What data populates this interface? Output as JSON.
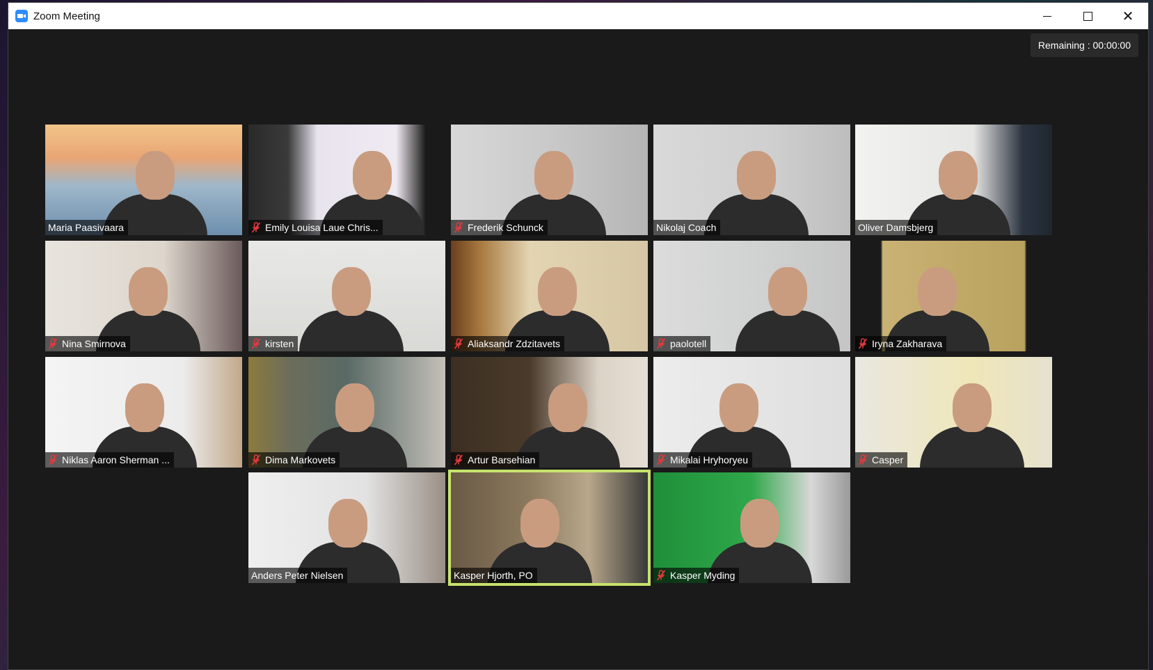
{
  "window": {
    "title": "Zoom Meeting"
  },
  "timer": {
    "label": "Remaining : 00:00:00"
  },
  "colors": {
    "speaking_outline": "#c7e36c",
    "mic_muted": "#e0393e",
    "zoom_blue": "#2D8CFF"
  },
  "participants": [
    {
      "name": "Maria Paasivaara",
      "muted": false,
      "speaking": false
    },
    {
      "name": "Emily Louisa Laue Chris...",
      "muted": true,
      "speaking": false
    },
    {
      "name": "Frederik Schunck",
      "muted": true,
      "speaking": false
    },
    {
      "name": "Nikolaj Coach",
      "muted": false,
      "speaking": false
    },
    {
      "name": "Oliver Damsbjerg",
      "muted": false,
      "speaking": false
    },
    {
      "name": "Nina Smirnova",
      "muted": true,
      "speaking": false
    },
    {
      "name": "kirsten",
      "muted": true,
      "speaking": false
    },
    {
      "name": "Aliaksandr Zdzitavets",
      "muted": true,
      "speaking": false
    },
    {
      "name": "paolotell",
      "muted": true,
      "speaking": false
    },
    {
      "name": "Iryna Zakharava",
      "muted": true,
      "speaking": false
    },
    {
      "name": "Niklas Aaron Sherman ...",
      "muted": true,
      "speaking": false
    },
    {
      "name": "Dima Markovets",
      "muted": true,
      "speaking": false
    },
    {
      "name": "Artur Barsehian",
      "muted": true,
      "speaking": false
    },
    {
      "name": "Mikalai Hryhoryeu",
      "muted": true,
      "speaking": false
    },
    {
      "name": "Casper",
      "muted": true,
      "speaking": false
    },
    {
      "name": "Anders Peter Nielsen",
      "muted": false,
      "speaking": false
    },
    {
      "name": "Kasper Hjorth, PO",
      "muted": false,
      "speaking": true
    },
    {
      "name": "Kasper Myding",
      "muted": true,
      "speaking": false
    }
  ]
}
